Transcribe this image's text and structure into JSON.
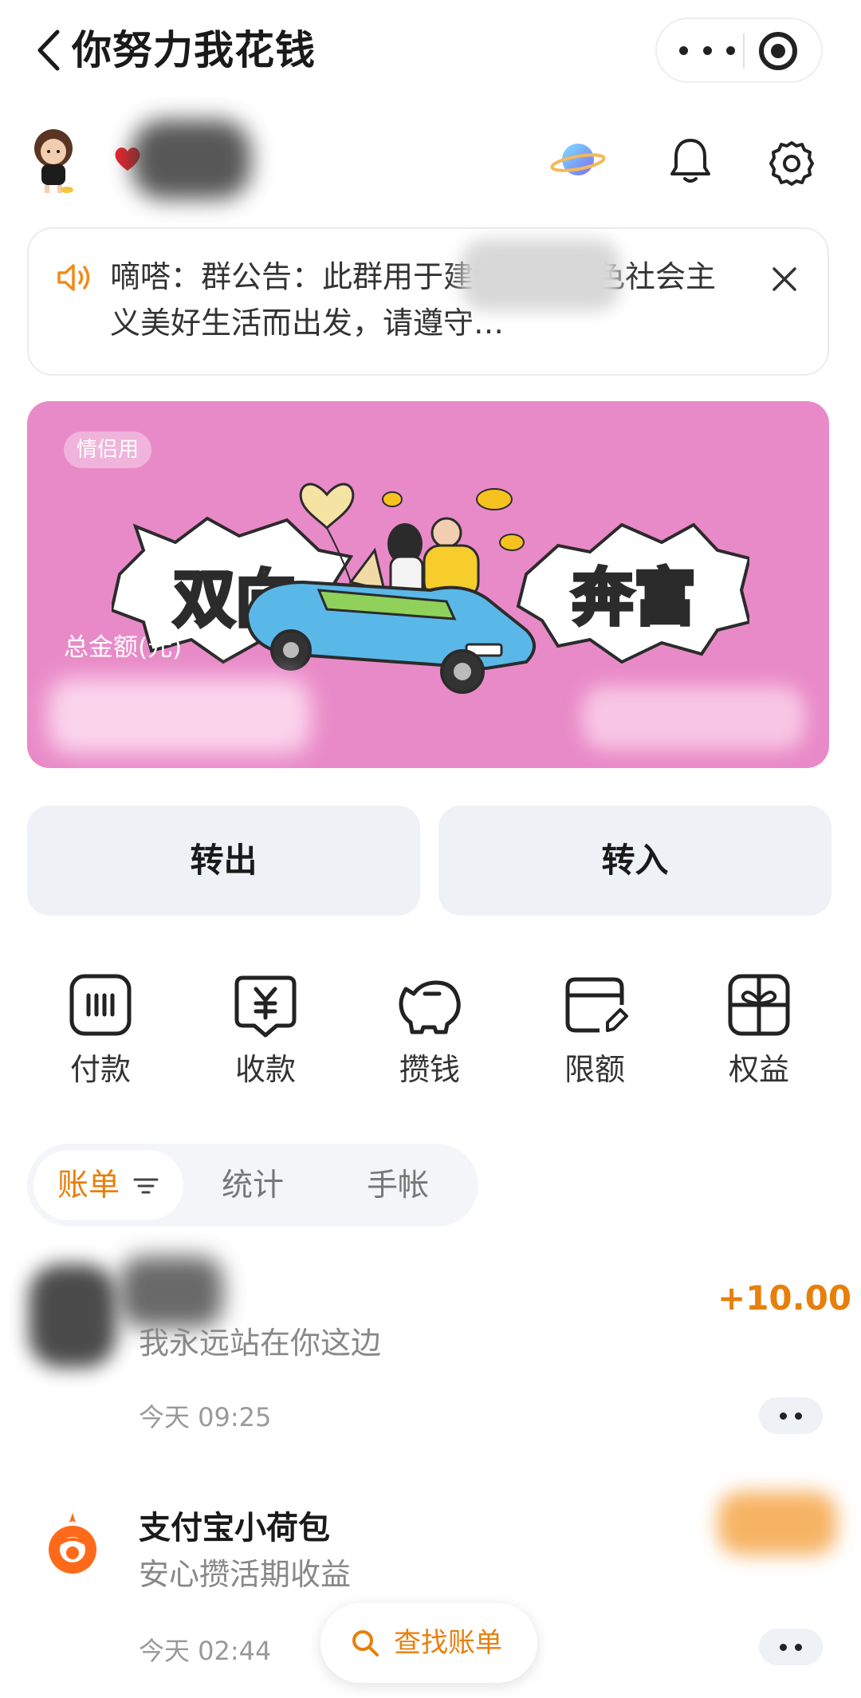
{
  "header": {
    "title": "你努力我花钱"
  },
  "notice": {
    "text": "嘀嗒：群公告：此群用于建设中国特色社会主义美好生活而出发，请遵守…"
  },
  "card": {
    "tag": "情侣用",
    "banner_left": "双向",
    "banner_right": "奔富",
    "total_label": "总金额(元)",
    "color": "#e98ac8"
  },
  "actions": {
    "transfer_out": "转出",
    "transfer_in": "转入"
  },
  "quick_actions": [
    {
      "label": "付款",
      "icon": "pay-icon"
    },
    {
      "label": "收款",
      "icon": "receive-icon"
    },
    {
      "label": "攒钱",
      "icon": "piggy-bank-icon"
    },
    {
      "label": "限额",
      "icon": "limit-card-icon"
    },
    {
      "label": "权益",
      "icon": "gift-icon"
    }
  ],
  "tabs": {
    "bill": "账单",
    "stats": "统计",
    "notebook": "手帐"
  },
  "transactions": [
    {
      "amount": "+10.00",
      "desc": "我永远站在你这边",
      "time": "今天 09:25"
    },
    {
      "title": "支付宝小荷包",
      "desc": "安心攒活期收益",
      "time": "今天 02:44"
    }
  ],
  "search": {
    "label": "查找账单"
  },
  "colors": {
    "accent": "#e87f0c",
    "card": "#e98ac8",
    "button_bg": "#eef1f6"
  }
}
